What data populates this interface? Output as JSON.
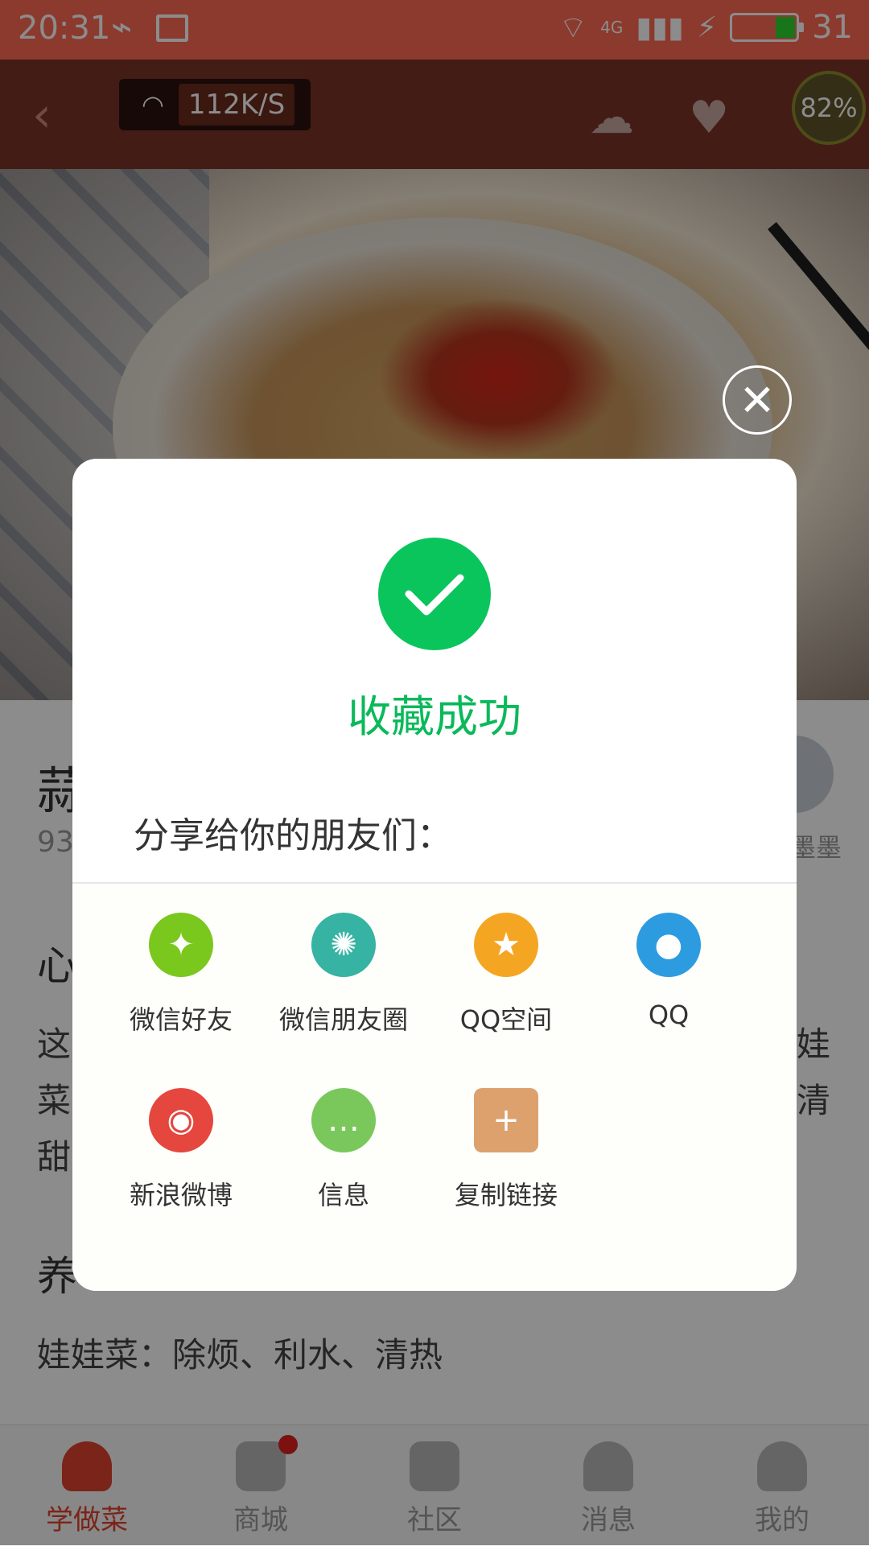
{
  "status_bar": {
    "time": "20:31",
    "network": "4G",
    "battery_level": "31"
  },
  "header": {
    "net_speed": "112K/S",
    "percent_badge": "82%"
  },
  "recipe": {
    "title_partial": "蒜",
    "meta_partial": "93",
    "author_partial": "墨墨",
    "section_1_partial": "心",
    "body_lines": [
      {
        "left": "这",
        "right": "娃"
      },
      {
        "left": "菜",
        "right": "清"
      },
      {
        "left": "甜",
        "right": ""
      }
    ],
    "section_2_partial": "养",
    "health_benefit": "娃娃菜：除烦、利水、清热"
  },
  "modal": {
    "success_title": "收藏成功",
    "share_prompt": "分享给你的朋友们：",
    "share_targets": [
      {
        "label": "微信好友",
        "icon": "wechat-icon",
        "color": "#7ac71e"
      },
      {
        "label": "微信朋友圈",
        "icon": "wechat-moments-icon",
        "color": "#36b3a3"
      },
      {
        "label": "QQ空间",
        "icon": "qzone-icon",
        "color": "#f4a623"
      },
      {
        "label": "QQ",
        "icon": "qq-icon",
        "color": "#2d9be0"
      },
      {
        "label": "新浪微博",
        "icon": "weibo-icon",
        "color": "#e5463e"
      },
      {
        "label": "信息",
        "icon": "message-icon",
        "color": "#7ac85c"
      },
      {
        "label": "复制链接",
        "icon": "copy-link-icon",
        "color": "#dca16d"
      }
    ]
  },
  "bottom_nav": {
    "items": [
      {
        "label": "学做菜",
        "icon": "chef-hat-icon",
        "active": true
      },
      {
        "label": "商城",
        "icon": "shopping-bag-icon",
        "active": false,
        "badge": true
      },
      {
        "label": "社区",
        "icon": "chat-icon",
        "active": false
      },
      {
        "label": "消息",
        "icon": "bell-icon",
        "active": false
      },
      {
        "label": "我的",
        "icon": "user-icon",
        "active": false
      }
    ]
  },
  "colors": {
    "status_bar": "#ff6a55",
    "success_green": "#0ac55b",
    "nav_active": "#e0432f"
  }
}
